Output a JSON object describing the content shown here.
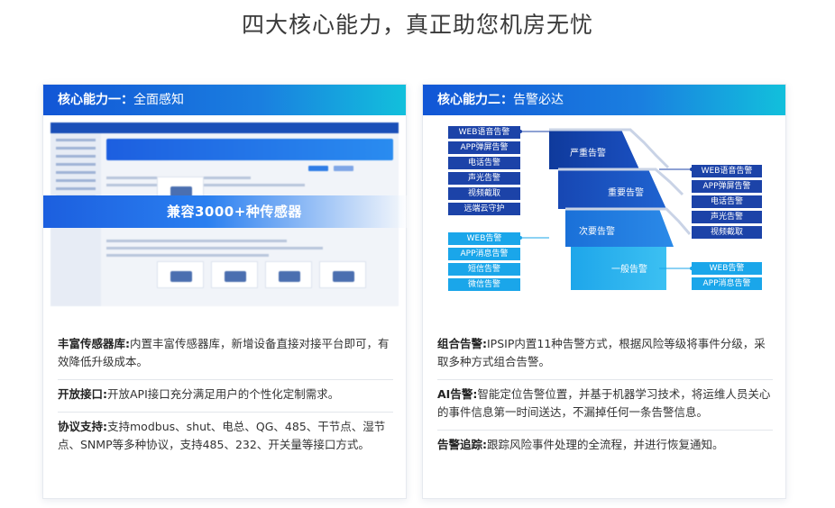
{
  "page": {
    "title": "四大核心能力，真正助您机房无忧"
  },
  "card1": {
    "header_prefix": "核心能力一：",
    "header_title": "全面感知",
    "overlay": "兼容3000+种传感器",
    "items": [
      {
        "label": "丰富传感器库:",
        "text": "内置丰富传感器库，新增设备直接对接平台即可，有效降低升级成本。"
      },
      {
        "label": "开放接口:",
        "text": "开放API接口充分满足用户的个性化定制需求。"
      },
      {
        "label": "协议支持:",
        "text": "支持modbus、shut、电总、QG、485、干节点、湿节点、SNMP等多种协议，支持485、232、开关量等接口方式。"
      }
    ]
  },
  "card2": {
    "header_prefix": "核心能力二：",
    "header_title": "告警必达",
    "diagram": {
      "left_dark": [
        "WEB语音告警",
        "APP弹屏告警",
        "电话告警",
        "声光告警",
        "视频截取",
        "远端云守护"
      ],
      "left_light": [
        "WEB告警",
        "APP消息告警",
        "短信告警",
        "微信告警"
      ],
      "tiers": [
        "严重告警",
        "重要告警",
        "次要告警",
        "一般告警"
      ],
      "right_dark": [
        "WEB语音告警",
        "APP弹屏告警",
        "电话告警",
        "声光告警",
        "视频截取"
      ],
      "right_light": [
        "WEB告警",
        "APP消息告警"
      ]
    },
    "items": [
      {
        "label": "组合告警:",
        "text": "IPSIP内置11种告警方式，根据风险等级将事件分级，采取多种方式组合告警。"
      },
      {
        "label": "AI告警:",
        "text": "智能定位告警位置，并基于机器学习技术，将运维人员关心的事件信息第一时间送达，不漏掉任何一条告警信息。"
      },
      {
        "label": "告警追踪:",
        "text": "跟踪风险事件处理的全流程，并进行恢复通知。"
      }
    ]
  },
  "colors": {
    "header_start": "#1256d6",
    "header_end": "#12c0dc",
    "tag_dark": "#1c43a8",
    "tag_light": "#1aa6ea"
  }
}
